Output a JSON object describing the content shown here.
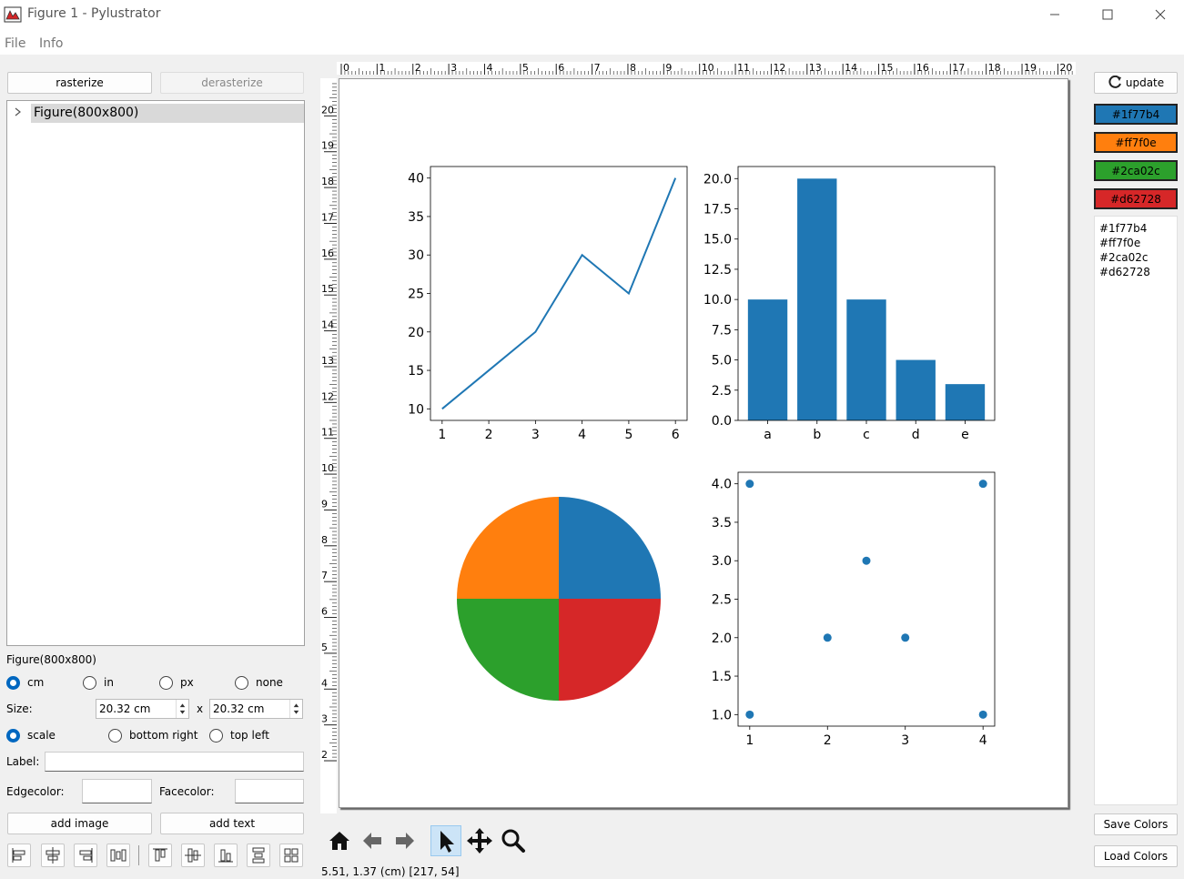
{
  "window": {
    "title": "Figure 1 - Pylustrator"
  },
  "menu": {
    "file": "File",
    "info": "Info"
  },
  "left": {
    "rasterize": "rasterize",
    "derasterize": "derasterize",
    "tree_item": "Figure(800x800)",
    "selected_label": "Figure(800x800)",
    "units": [
      "cm",
      "in",
      "px",
      "none"
    ],
    "unit_selected": "cm",
    "size_label": "Size:",
    "width_value": "20.32 cm",
    "height_value": "20.32 cm",
    "size_sep": "x",
    "anchors": [
      "scale",
      "bottom right",
      "top left"
    ],
    "anchor_selected": "scale",
    "label_label": "Label:",
    "label_value": "",
    "edgecolor_label": "Edgecolor:",
    "facecolor_label": "Facecolor:",
    "add_image": "add image",
    "add_text": "add text"
  },
  "ruler": {
    "h_labels": [
      "0",
      "1",
      "2",
      "3",
      "4",
      "5",
      "6",
      "7",
      "8",
      "9",
      "10",
      "11",
      "12",
      "13",
      "14",
      "15",
      "16",
      "17",
      "18",
      "19",
      "20"
    ],
    "v_labels": [
      "20",
      "19",
      "18",
      "17",
      "16",
      "15",
      "14",
      "13",
      "12",
      "11",
      "10",
      "9",
      "8",
      "7",
      "6",
      "5",
      "4",
      "3",
      "2"
    ]
  },
  "right": {
    "update": "update",
    "colors": [
      {
        "label": "#1f77b4",
        "color": "#1f77b4"
      },
      {
        "label": "#ff7f0e",
        "color": "#ff7f0e"
      },
      {
        "label": "#2ca02c",
        "color": "#2ca02c"
      },
      {
        "label": "#d62728",
        "color": "#d62728"
      }
    ],
    "colors_text": [
      "#1f77b4",
      "#ff7f0e",
      "#2ca02c",
      "#d62728"
    ],
    "save_colors": "Save Colors",
    "load_colors": "Load Colors"
  },
  "status": {
    "coords": "5.51, 1.37 (cm) [217, 54]"
  },
  "chart_data": [
    {
      "type": "line",
      "x": [
        1,
        2,
        3,
        4,
        5,
        6
      ],
      "y": [
        10,
        15,
        20,
        30,
        25,
        40
      ],
      "xticks": [
        "1",
        "2",
        "3",
        "4",
        "5",
        "6"
      ],
      "yticks": [
        "10",
        "15",
        "20",
        "25",
        "30",
        "35",
        "40"
      ],
      "xlim": [
        0.75,
        6.25
      ],
      "ylim": [
        8.5,
        41.5
      ],
      "color": "#1f77b4",
      "grid": false
    },
    {
      "type": "bar",
      "categories": [
        "a",
        "b",
        "c",
        "d",
        "e"
      ],
      "values": [
        10,
        20,
        10,
        5,
        3
      ],
      "yticks": [
        "0.0",
        "2.5",
        "5.0",
        "7.5",
        "10.0",
        "12.5",
        "15.0",
        "17.5",
        "20.0"
      ],
      "ylim": [
        0,
        21
      ],
      "color": "#1f77b4",
      "grid": false
    },
    {
      "type": "pie",
      "values": [
        25,
        25,
        25,
        25
      ],
      "colors": [
        "#1f77b4",
        "#ff7f0e",
        "#2ca02c",
        "#d62728"
      ]
    },
    {
      "type": "scatter",
      "x": [
        1,
        4,
        2.5,
        2,
        3,
        1,
        4
      ],
      "y": [
        4,
        4,
        3,
        2,
        2,
        1,
        1
      ],
      "xticks": [
        "1",
        "2",
        "3",
        "4"
      ],
      "yticks": [
        "1.0",
        "1.5",
        "2.0",
        "2.5",
        "3.0",
        "3.5",
        "4.0"
      ],
      "xlim": [
        0.85,
        4.15
      ],
      "ylim": [
        0.85,
        4.15
      ],
      "color": "#1f77b4",
      "grid": false
    }
  ]
}
